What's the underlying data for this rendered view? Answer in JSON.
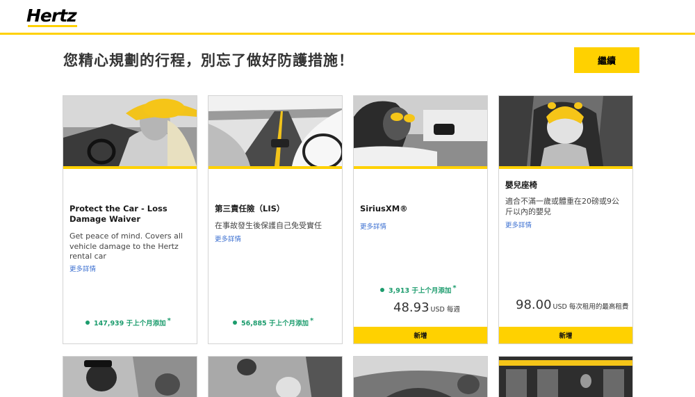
{
  "header": {
    "logo": "Hertz"
  },
  "headline": "您精心規劃的行程，別忘了做好防護措施！",
  "continue_label": "繼續",
  "cards": [
    {
      "title": "Protect the Car - Loss Damage Waiver",
      "description": "Get peace of mind. Covers all vehicle damage to the Hertz rental car",
      "more": "更多詳情",
      "stat": "147,939 于上个月添加",
      "stat_mark": "*"
    },
    {
      "title": "第三責任險（LIS）",
      "description": "在事故發生後保護自己免受實任",
      "more": "更多詳情",
      "stat": "56,885 于上个月添加",
      "stat_mark": "*"
    },
    {
      "title": "SiriusXM®",
      "more": "更多詳情",
      "stat": "3,913 于上个月添加",
      "stat_mark": "*",
      "price": "48.93",
      "price_unit": "USD 每週",
      "add_label": "新增"
    },
    {
      "title": "嬰兒座椅",
      "description": "適合不滿一歲或體重在20磅或9公斤以內的嬰兒",
      "more": "更多詳情",
      "price": "98.00",
      "price_unit": "USD 每次租用的最高租費",
      "add_label": "新增"
    }
  ],
  "colors": {
    "brand_yellow": "#ffd100",
    "stat_green": "#1c9c6d",
    "link_blue": "#3b6fd0"
  }
}
